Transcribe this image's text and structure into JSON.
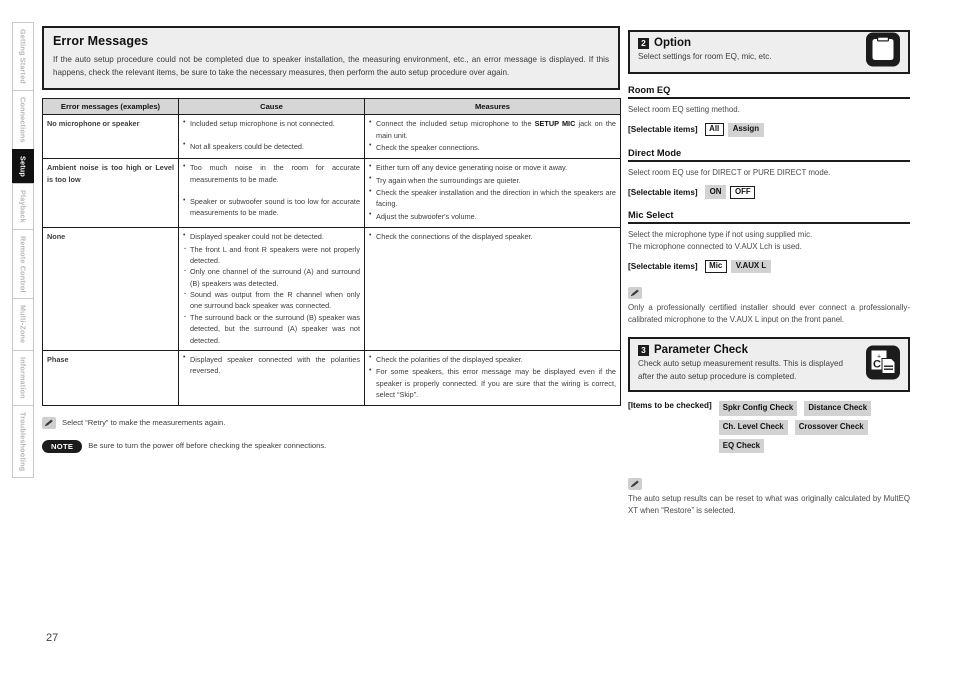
{
  "sidebar": {
    "items": [
      {
        "label": "Getting Started",
        "active": false
      },
      {
        "label": "Connections",
        "active": false
      },
      {
        "label": "Setup",
        "active": true
      },
      {
        "label": "Playback",
        "active": false
      },
      {
        "label": "Remote Control",
        "active": false
      },
      {
        "label": "Multi-Zone",
        "active": false
      },
      {
        "label": "Information",
        "active": false
      },
      {
        "label": "Troubleshooting",
        "active": false
      }
    ]
  },
  "page_number": "27",
  "error_messages": {
    "title": "Error Messages",
    "intro": "If the auto setup procedure could not be completed due to speaker installation, the measuring environment, etc., an error message is displayed. If this happens, check the relevant items, be sure to take the necessary measures, then perform the auto setup procedure over again.",
    "columns": [
      "Error messages (examples)",
      "Cause",
      "Measures"
    ],
    "rows": [
      {
        "message": "No microphone or speaker",
        "cause": [
          "Included setup microphone is not connected.",
          "Not all speakers could be detected."
        ],
        "measures": [
          "Connect the included setup microphone to the SETUP MIC jack on the main unit.",
          "Check the speaker connections."
        ]
      },
      {
        "message": "Ambient noise is too high or Level is too low",
        "cause": [
          "Too much noise in the room for accurate measurements to be made.",
          "Speaker or subwoofer sound is too low for accurate measurements to be made."
        ],
        "measures": [
          "Either turn off any device generating noise or move it away.",
          "Try again when the surroundings are quieter.",
          "Check the speaker installation and the direction in which the speakers are facing.",
          "Adjust the subwoofer's volume."
        ]
      },
      {
        "message": "None",
        "cause": [
          "Displayed speaker could not be detected."
        ],
        "cause_sub": [
          "The front L and front R speakers were not properly detected.",
          "Only one channel of the surround (A) and surround (B) speakers was detected.",
          "Sound was output from the R channel when only one surround back speaker was connected.",
          "The surround back or the surround (B) speaker was detected, but the surround (A) speaker was not detected."
        ],
        "measures": [
          "Check the connections of the displayed speaker."
        ]
      },
      {
        "message": "Phase",
        "cause": [
          "Displayed speaker connected with the polarities reversed."
        ],
        "measures": [
          "Check the polarities of the displayed speaker.",
          "For some speakers, this error message may be displayed even if the speaker is properly connected. If you are sure that the wiring is correct, select “Skip”."
        ]
      }
    ],
    "tip": "Select “Retry” to make the measurements again.",
    "note_label": "NOTE",
    "note_text": "Be sure to turn the power off before checking the speaker connections."
  },
  "option": {
    "number": "2",
    "title": "Option",
    "subtitle": "Select settings for room EQ, mic, etc.",
    "icon": "clipboard-icon",
    "sections": [
      {
        "heading": "Room EQ",
        "desc": "Select room EQ setting method.",
        "sel_label": "[Selectable items]",
        "chips": [
          {
            "label": "All",
            "style": "outlined"
          },
          {
            "label": "Assign",
            "style": "filled"
          }
        ]
      },
      {
        "heading": "Direct Mode",
        "desc": "Select room EQ use for DIRECT or PURE DIRECT mode.",
        "sel_label": "[Selectable items]",
        "chips": [
          {
            "label": "ON",
            "style": "filled"
          },
          {
            "label": "OFF",
            "style": "outlined"
          }
        ]
      },
      {
        "heading": "Mic Select",
        "desc": "Select the microphone type if not using supplied mic.\nThe microphone connected to V.AUX Lch is used.",
        "sel_label": "[Selectable items]",
        "chips": [
          {
            "label": "Mic",
            "style": "outlined"
          },
          {
            "label": "V.AUX L",
            "style": "filled"
          }
        ]
      }
    ],
    "tip": "Only a professionally certified installer should ever connect a professionally-calibrated microphone to the V.AUX L input on the front panel."
  },
  "parameter_check": {
    "number": "3",
    "title": "Parameter Check",
    "subtitle": "Check auto setup measurement results.\nThis is displayed after the auto setup procedure is completed.",
    "icon": "report-check-icon",
    "items_label": "[Items to be checked]",
    "items": [
      "Spkr Config Check",
      "Distance Check",
      "Ch. Level Check",
      "Crossover Check",
      "EQ Check"
    ],
    "tip": "The auto setup results can be reset to what was originally calculated by MultEQ XT when “Restore” is selected."
  }
}
